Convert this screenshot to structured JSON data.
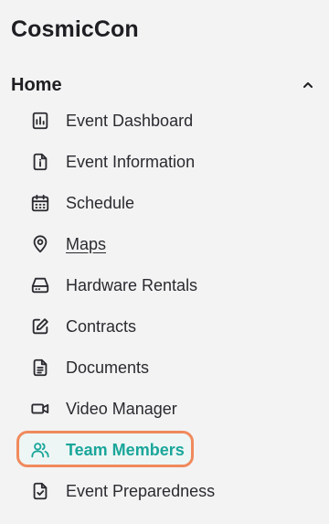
{
  "app": {
    "title": "CosmicCon"
  },
  "section": {
    "label": "Home",
    "collapse_icon": "chevron-up-icon"
  },
  "nav": {
    "items": [
      {
        "label": "Event Dashboard",
        "icon": "bar-chart-icon"
      },
      {
        "label": "Event Information",
        "icon": "info-document-icon"
      },
      {
        "label": "Schedule",
        "icon": "calendar-icon"
      },
      {
        "label": "Maps",
        "icon": "map-pin-icon"
      },
      {
        "label": "Hardware Rentals",
        "icon": "hard-drive-icon"
      },
      {
        "label": "Contracts",
        "icon": "edit-icon"
      },
      {
        "label": "Documents",
        "icon": "document-icon"
      },
      {
        "label": "Video Manager",
        "icon": "video-camera-icon"
      },
      {
        "label": "Team Members",
        "icon": "users-icon"
      },
      {
        "label": "Event Preparedness",
        "icon": "checklist-document-icon"
      }
    ],
    "active_label": "Team Members"
  },
  "colors": {
    "accent": "#1aa69a",
    "focus_ring": "#f08a5d",
    "background": "#f3f3f3",
    "text": "#1e1e23"
  }
}
